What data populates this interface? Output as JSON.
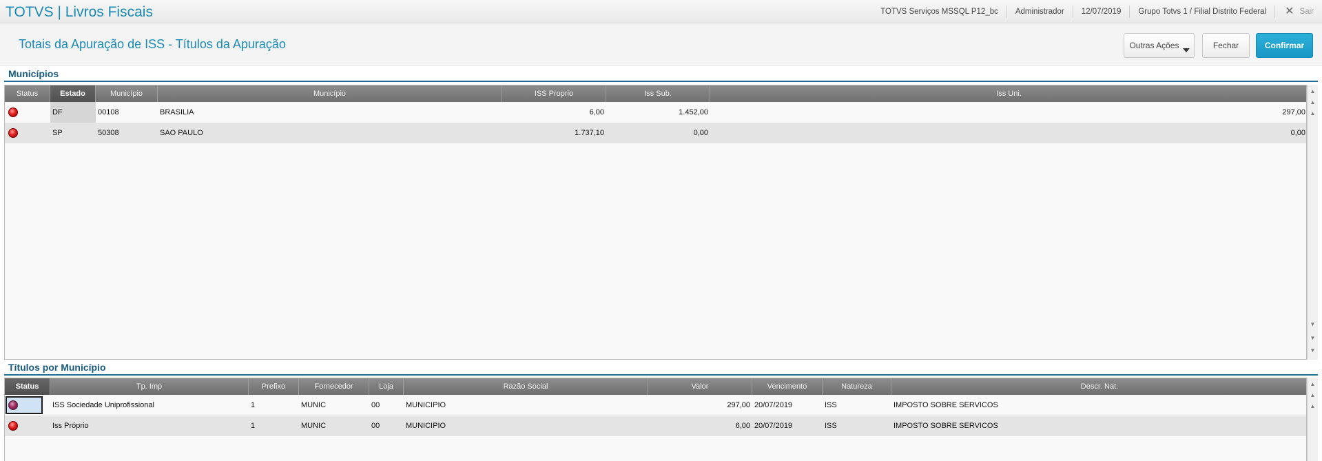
{
  "app": {
    "title": "TOTVS | Livros Fiscais",
    "environment": "TOTVS Serviços MSSQL P12_bc",
    "user": "Administrador",
    "date": "12/07/2019",
    "branch": "Grupo Totvs 1 / Filial Distrito Federal",
    "logout_label": "Sair"
  },
  "page": {
    "title": "Totais da Apuração de ISS - Títulos da Apuração",
    "buttons": {
      "outras_acoes": "Outras Ações",
      "fechar": "Fechar",
      "confirmar": "Confirmar"
    }
  },
  "municipios": {
    "section_title": "Municípios",
    "columns": [
      "Status",
      "Estado",
      "Município",
      "Município",
      "ISS Proprio",
      "Iss Sub.",
      "Iss Uni."
    ],
    "rows": [
      {
        "estado": "DF",
        "codigo": "00108",
        "municipio": "BRASILIA",
        "iss_proprio": "6,00",
        "iss_sub": "1.452,00",
        "iss_uni": "297,00"
      },
      {
        "estado": "SP",
        "codigo": "50308",
        "municipio": "SAO PAULO",
        "iss_proprio": "1.737,10",
        "iss_sub": "0,00",
        "iss_uni": "0,00"
      }
    ]
  },
  "titulos": {
    "section_title": "Títulos por Município",
    "columns": [
      "Status",
      "Tp. Imp",
      "Prefixo",
      "Fornecedor",
      "Loja",
      "Razão Social",
      "Valor",
      "Vencimento",
      "Natureza",
      "Descr. Nat."
    ],
    "rows": [
      {
        "tp_imp": "ISS Sociedade Uniprofissional",
        "prefixo": "1",
        "fornecedor": "MUNIC",
        "loja": "00",
        "razao_social": "MUNICIPIO",
        "valor": "297,00",
        "vencimento": "20/07/2019",
        "natureza": "ISS",
        "descr_nat": "IMPOSTO SOBRE SERVICOS"
      },
      {
        "tp_imp": "Iss Próprio",
        "prefixo": "1",
        "fornecedor": "MUNIC",
        "loja": "00",
        "razao_social": "MUNICIPIO",
        "valor": "6,00",
        "vencimento": "20/07/2019",
        "natureza": "ISS",
        "descr_nat": "IMPOSTO SOBRE SERVICOS"
      }
    ]
  },
  "colors": {
    "accent": "#1a8ab5",
    "section": "#185b7e",
    "confirm_button": "#1a98c6",
    "status_red": "#e02020"
  },
  "icons": {
    "logout": "close-icon",
    "status": "red-status-dot-icon",
    "dropdown": "caret-down-icon"
  }
}
